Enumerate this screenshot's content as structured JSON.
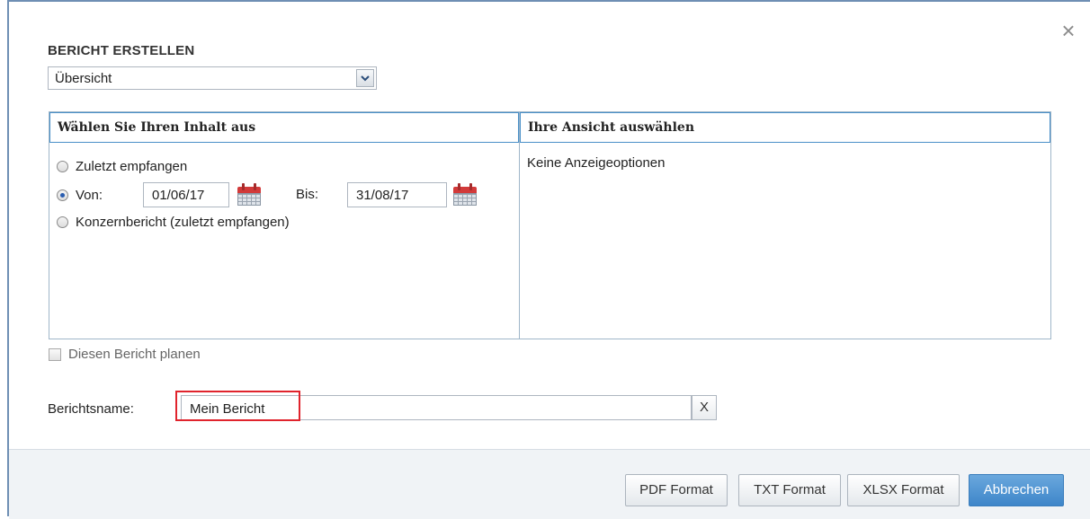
{
  "dialog": {
    "title": "BERICHT ERSTELLEN",
    "close_symbol": "×",
    "report_type": {
      "selected": "Übersicht"
    }
  },
  "left_panel": {
    "header": "Wählen Sie Ihren Inhalt aus",
    "options": [
      {
        "label": "Zuletzt empfangen",
        "checked": false
      },
      {
        "label": "Von:",
        "checked": true
      },
      {
        "label": "Konzernbericht (zuletzt empfangen)",
        "checked": false
      }
    ],
    "from_date": "01/06/17",
    "to_label": "Bis:",
    "to_date": "31/08/17"
  },
  "right_panel": {
    "header": "Ihre Ansicht auswählen",
    "message": "Keine Anzeigeoptionen"
  },
  "schedule": {
    "label": "Diesen Bericht planen",
    "checked": false
  },
  "report_name": {
    "label": "Berichtsname:",
    "value": "Mein Bericht",
    "clear_label": "X"
  },
  "footer": {
    "buttons": [
      "PDF Format",
      "TXT Format",
      "XLSX Format",
      "Abbrechen"
    ]
  },
  "colors": {
    "accent": "#4a90c8",
    "primary_button": "#4d94d2",
    "highlight": "#e0242d",
    "calendar": "#d23a3a"
  },
  "icons": [
    "close-icon",
    "chevron-down-icon",
    "calendar-icon"
  ]
}
